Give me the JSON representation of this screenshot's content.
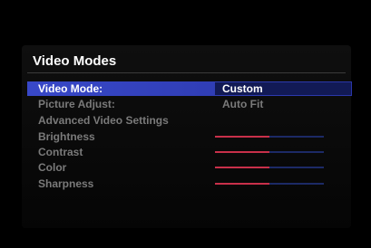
{
  "menu": {
    "title": "Video Modes",
    "items": [
      {
        "label": "Video Mode:",
        "value": "Custom"
      },
      {
        "label": "Picture Adjust:",
        "value": "Auto Fit"
      },
      {
        "label": "Advanced Video Settings"
      },
      {
        "label": "Brightness",
        "level": 0.5
      },
      {
        "label": "Contrast",
        "level": 0.5
      },
      {
        "label": "Color",
        "level": 0.5
      },
      {
        "label": "Sharpness",
        "level": 0.5
      }
    ]
  },
  "colors": {
    "selection": "#3848c8",
    "slider_fill": "#c8304a",
    "slider_track": "#1c2a66",
    "dim_text": "#7a7a7a"
  }
}
